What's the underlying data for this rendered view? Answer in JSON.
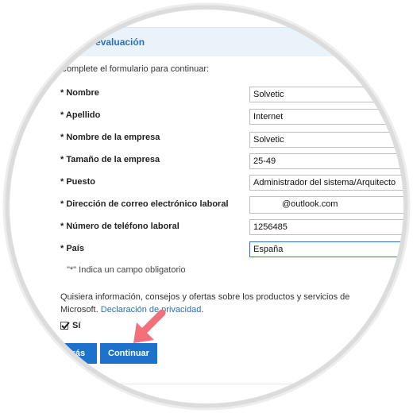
{
  "header": {
    "title": "...ce su evaluación"
  },
  "form": {
    "intro": "Complete el formulario para continuar:",
    "fields": [
      {
        "label": "* Nombre",
        "value": "Solvetic"
      },
      {
        "label": "* Apellido",
        "value": "Internet"
      },
      {
        "label": "* Nombre de la empresa",
        "value": "Solvetic"
      },
      {
        "label": "* Tamaño de la empresa",
        "value": "25-49"
      },
      {
        "label": "* Puesto",
        "value": "Administrador del sistema/Arquitecto"
      },
      {
        "label": "* Dirección de correo electrónico laboral",
        "value": "@outlook.com"
      },
      {
        "label": "* Número de teléfono laboral",
        "value": "1256485"
      },
      {
        "label": "* País",
        "value": "España"
      }
    ],
    "required_note": "\"*\" Indica un campo obligatorio",
    "consent_text": "Quisiera información, consejos y ofertas sobre los productos y servicios de Microsoft.",
    "privacy_link": "Declaración de privacidad",
    "consent_period": ".",
    "checkbox_label": "Sí",
    "checkbox_checked": true
  },
  "buttons": {
    "back": "Atrás",
    "continue": "Continuar"
  },
  "colors": {
    "accent": "#1d73c9",
    "header_bg": "#eaf2fa",
    "link": "#2a6fbd",
    "arrow": "#f2707a"
  }
}
